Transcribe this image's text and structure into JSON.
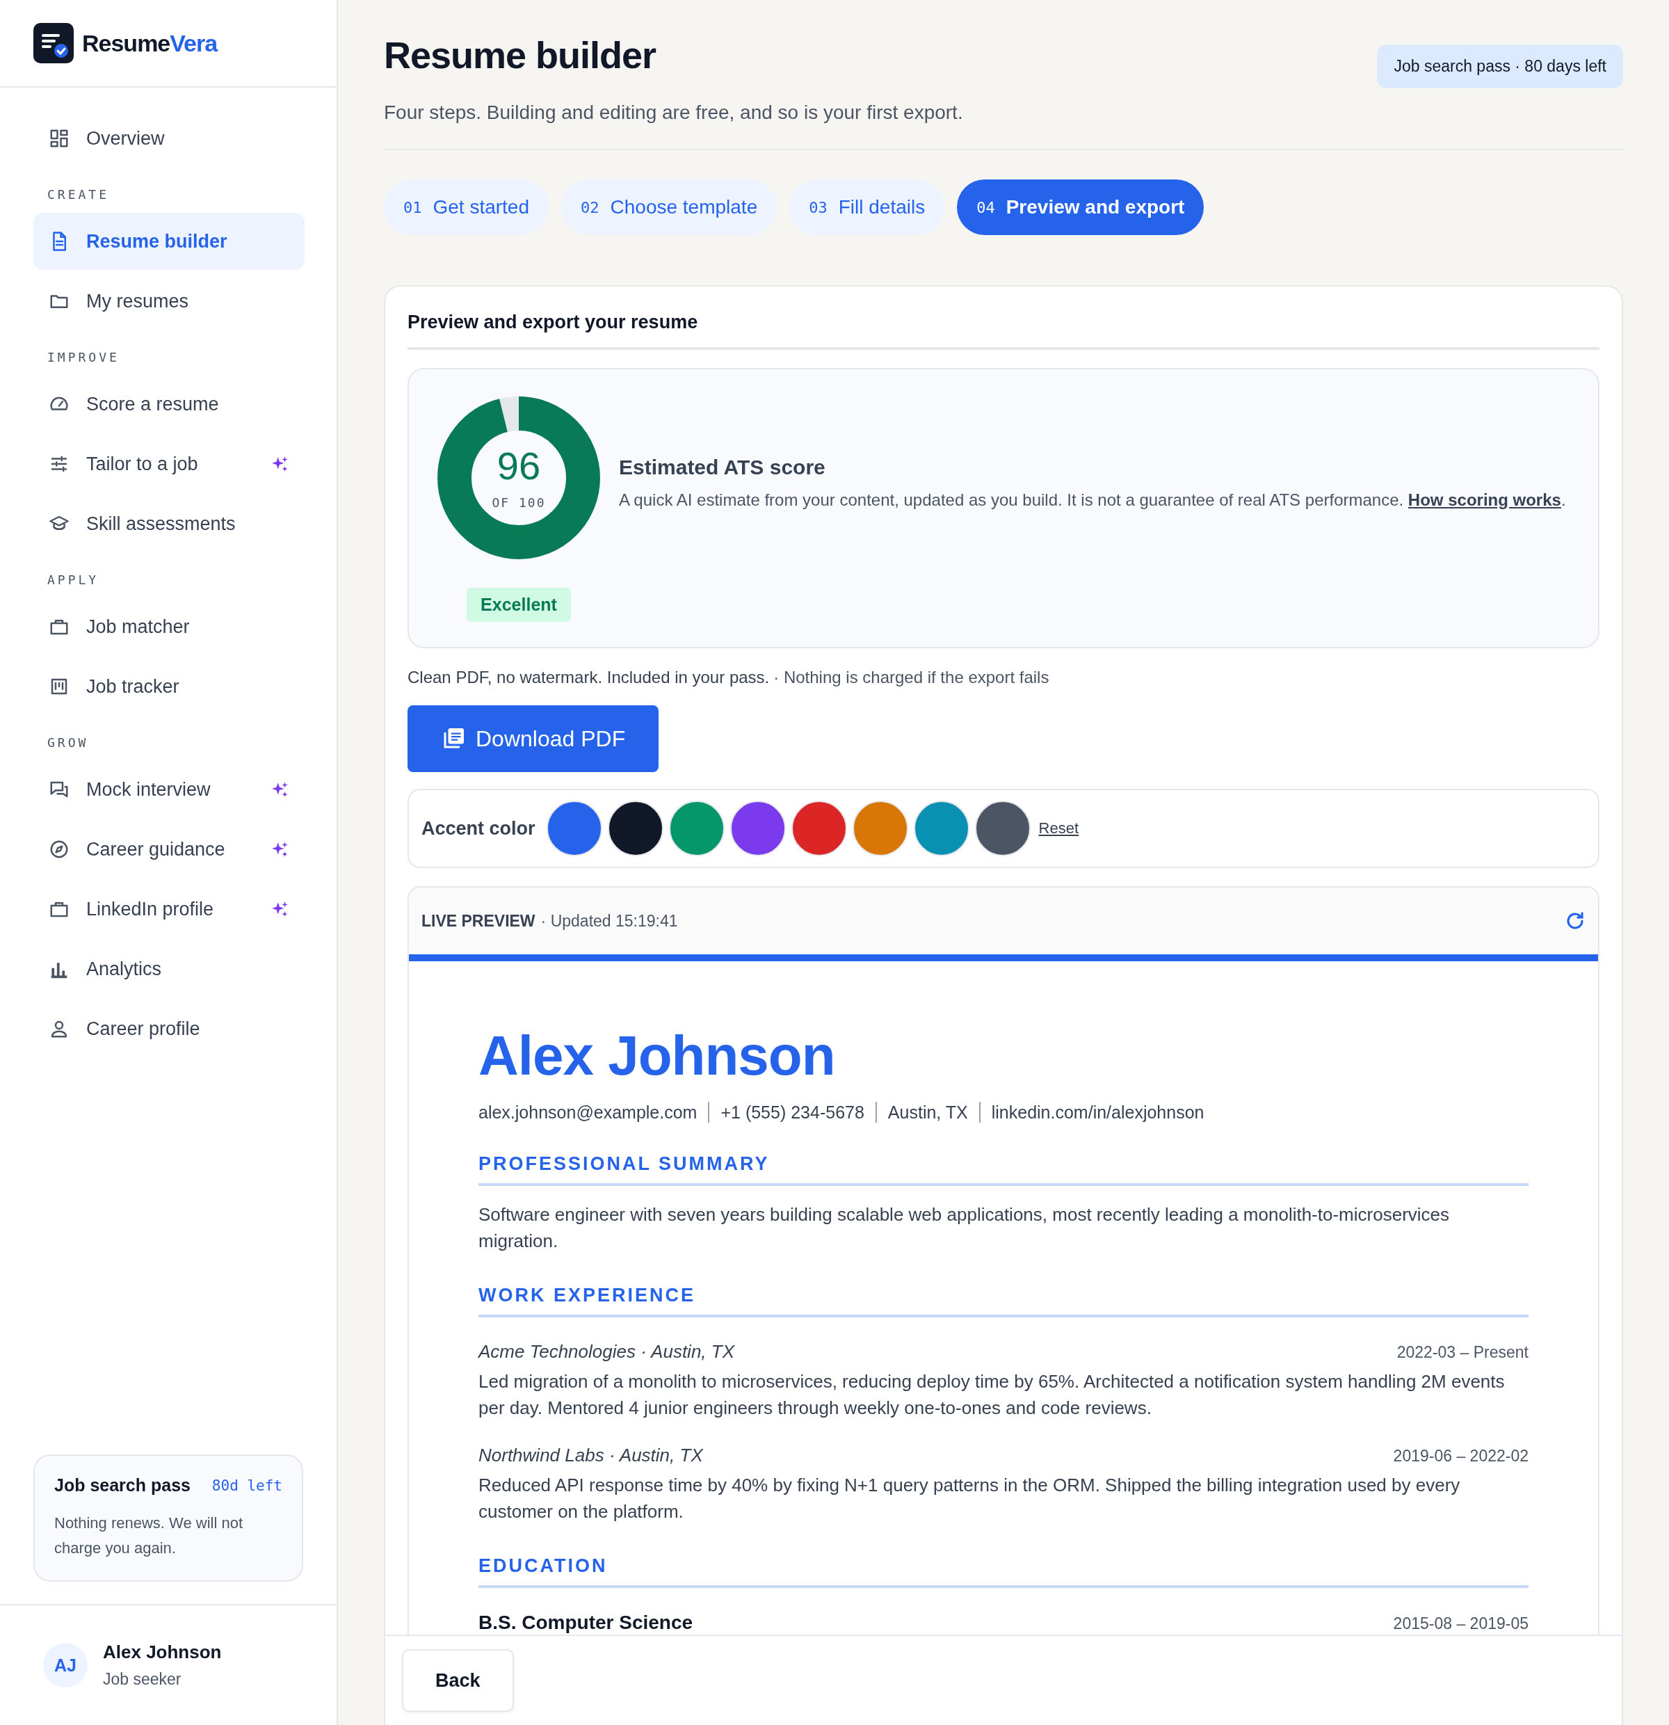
{
  "brand": {
    "name": "Resume",
    "accent": "Vera"
  },
  "nav": [
    {
      "kind": "link",
      "label": "Overview",
      "selected": false,
      "ai": false
    },
    {
      "kind": "heading",
      "label": "CREATE"
    },
    {
      "kind": "link",
      "label": "Resume builder",
      "selected": true,
      "ai": false
    },
    {
      "kind": "link",
      "label": "My resumes",
      "selected": false,
      "ai": false
    },
    {
      "kind": "heading",
      "label": "IMPROVE"
    },
    {
      "kind": "link",
      "label": "Score a resume",
      "selected": false,
      "ai": false
    },
    {
      "kind": "link",
      "label": "Tailor to a job",
      "selected": false,
      "ai": true
    },
    {
      "kind": "link",
      "label": "Skill assessments",
      "selected": false,
      "ai": false
    },
    {
      "kind": "heading",
      "label": "APPLY"
    },
    {
      "kind": "link",
      "label": "Job matcher",
      "selected": false,
      "ai": false
    },
    {
      "kind": "link",
      "label": "Job tracker",
      "selected": false,
      "ai": false
    },
    {
      "kind": "heading",
      "label": "GROW"
    },
    {
      "kind": "link",
      "label": "Mock interview",
      "selected": false,
      "ai": true
    },
    {
      "kind": "link",
      "label": "Career guidance",
      "selected": false,
      "ai": true
    },
    {
      "kind": "link",
      "label": "LinkedIn profile",
      "selected": false,
      "ai": true
    },
    {
      "kind": "link",
      "label": "Analytics",
      "selected": false,
      "ai": false
    },
    {
      "kind": "link",
      "label": "Career profile",
      "selected": false,
      "ai": false
    }
  ],
  "pass_card": {
    "title": "Job search pass",
    "remaining": "80d left",
    "note": "Nothing renews. We will not charge you again."
  },
  "user": {
    "initials": "AJ",
    "name": "Alex Johnson",
    "role": "Job seeker"
  },
  "header": {
    "title": "Resume builder",
    "subtitle": "Four steps. Building and editing are free, and so is your first export.",
    "pass_badge": "Job search pass · 80 days left"
  },
  "steps": [
    {
      "number": "01",
      "label": "Get started",
      "selected": false
    },
    {
      "number": "02",
      "label": "Choose template",
      "selected": false
    },
    {
      "number": "03",
      "label": "Fill details",
      "selected": false
    },
    {
      "number": "04",
      "label": "Preview and export",
      "selected": true
    }
  ],
  "panel": {
    "title": "Preview and export your resume",
    "ats": {
      "score": "96",
      "out_of": "OF 100",
      "level": 0.96,
      "rating": "Excellent",
      "heading": "Estimated ATS score",
      "description": "A quick AI estimate from your content, updated as you build. It is not a guarantee of real ATS performance.",
      "link": "How scoring works",
      "tail": "."
    },
    "export_note": "Clean PDF, no watermark. Included in your pass.",
    "export_guarantee": "· Nothing is charged if the export fails",
    "download_button": "Download PDF",
    "accent": {
      "label": "Accent color",
      "reset": "Reset",
      "swatches": [
        {
          "color": "#2563eb"
        },
        {
          "color": "#111827"
        },
        {
          "color": "#059669"
        },
        {
          "color": "#7c3aed"
        },
        {
          "color": "#dc2626"
        },
        {
          "color": "#d97706"
        },
        {
          "color": "#0891b2"
        },
        {
          "color": "#4b5563"
        }
      ]
    },
    "preview": {
      "label": "LIVE PREVIEW",
      "updated": "· Updated 15:19:41",
      "resume": {
        "name": "Alex Johnson",
        "contacts": [
          "alex.johnson@example.com",
          "+1 (555) 234-5678",
          "Austin, TX",
          "linkedin.com/in/alexjohnson"
        ],
        "sections": [
          {
            "kind": "summary",
            "heading": "PROFESSIONAL SUMMARY",
            "text": "Software engineer with seven years building scalable web applications, most recently leading a monolith-to-microservices migration."
          },
          {
            "kind": "experience",
            "heading": "WORK EXPERIENCE",
            "entries": [
              {
                "org": "Acme Technologies · Austin, TX",
                "dates": "2022-03 – Present",
                "text": "Led migration of a monolith to microservices, reducing deploy time by 65%. Architected a notification system handling 2M events per day. Mentored 4 junior engineers through weekly one-to-ones and code reviews."
              },
              {
                "org": "Northwind Labs · Austin, TX",
                "dates": "2019-06 – 2022-02",
                "text": "Reduced API response time by 40% by fixing N+1 query patterns in the ORM. Shipped the billing integration used by every customer on the platform."
              }
            ]
          },
          {
            "kind": "education",
            "heading": "EDUCATION",
            "entries": [
              {
                "degree": "B.S. Computer Science",
                "dates": "2015-08 – 2019-05"
              }
            ]
          }
        ]
      }
    }
  },
  "footer": {
    "back": "Back"
  }
}
